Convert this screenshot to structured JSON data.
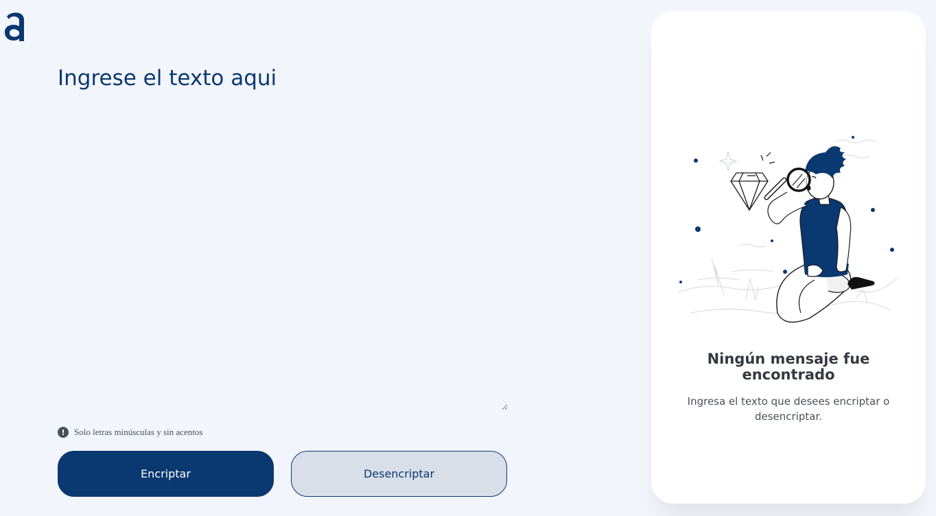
{
  "logo": {
    "icon": "alura-logo-icon"
  },
  "input": {
    "placeholder": "Ingrese el texto aqui",
    "value": ""
  },
  "hint": {
    "icon": "exclamation-circle-icon",
    "text": "Solo letras minúsculas y sin acentos"
  },
  "actions": {
    "encrypt_label": "Encriptar",
    "decrypt_label": "Desencriptar"
  },
  "output": {
    "illustration": "person-with-magnifying-glass-illustration",
    "title": "Ningún mensaje fue encontrado",
    "description": "Ingresa el texto que desees encriptar o desencriptar."
  },
  "colors": {
    "background": "#f3f5fc",
    "primary": "#0a3871",
    "secondary_button_bg": "#d8dfe8",
    "panel_bg": "#ffffff",
    "title_text": "#343a40",
    "body_text": "#495057"
  }
}
